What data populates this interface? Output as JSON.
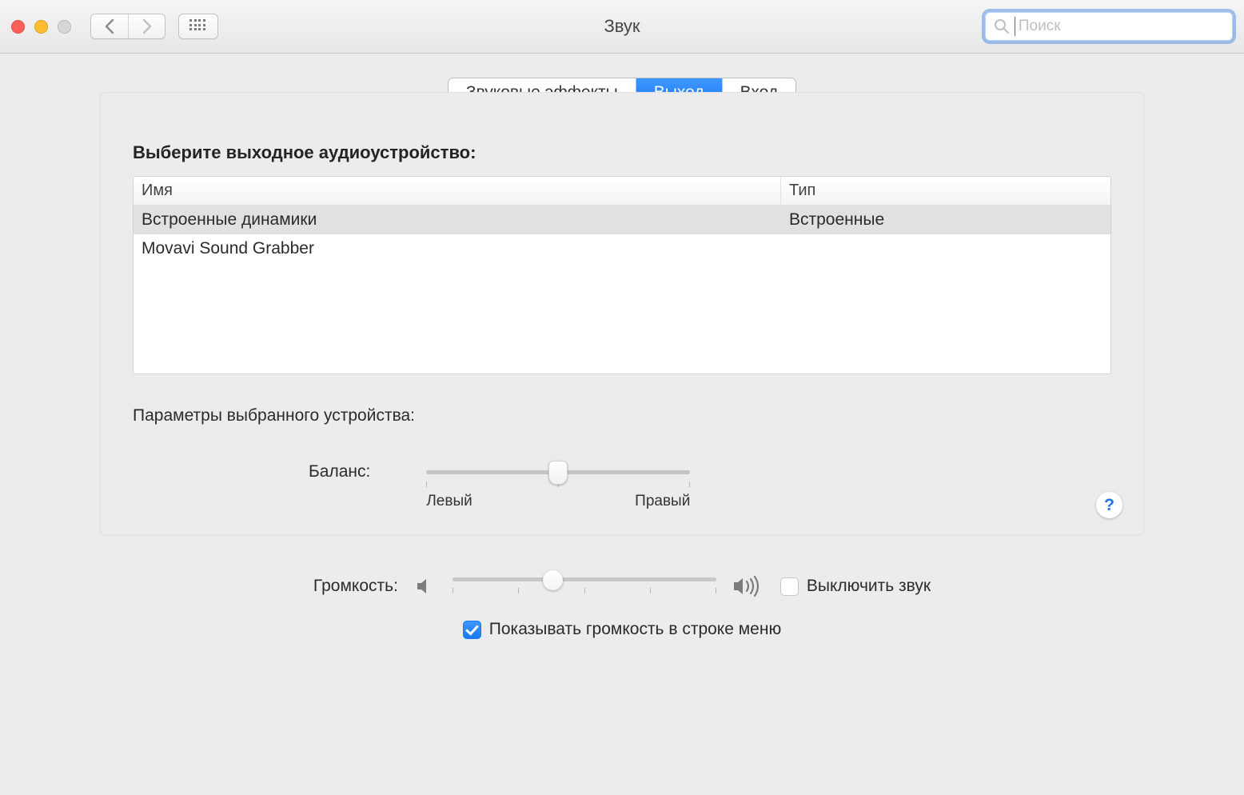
{
  "window": {
    "title": "Звук"
  },
  "search": {
    "placeholder": "Поиск"
  },
  "tabs": {
    "effects": "Звуковые эффекты",
    "output": "Выход",
    "input": "Вход"
  },
  "main": {
    "select_device_heading": "Выберите выходное аудиоустройство:",
    "table": {
      "col_name": "Имя",
      "col_type": "Тип",
      "rows": [
        {
          "name": "Встроенные динамики",
          "type": "Встроенные"
        },
        {
          "name": "Movavi Sound Grabber",
          "type": ""
        }
      ]
    },
    "selected_settings_label": "Параметры выбранного устройства:",
    "balance": {
      "label": "Баланс:",
      "left": "Левый",
      "right": "Правый",
      "value_percent": 50
    },
    "help": "?"
  },
  "volume": {
    "label": "Громкость:",
    "value_percent": 38,
    "mute_label": "Выключить звук",
    "mute_checked": false,
    "show_menu_label": "Показывать громкость в строке меню",
    "show_menu_checked": true
  }
}
